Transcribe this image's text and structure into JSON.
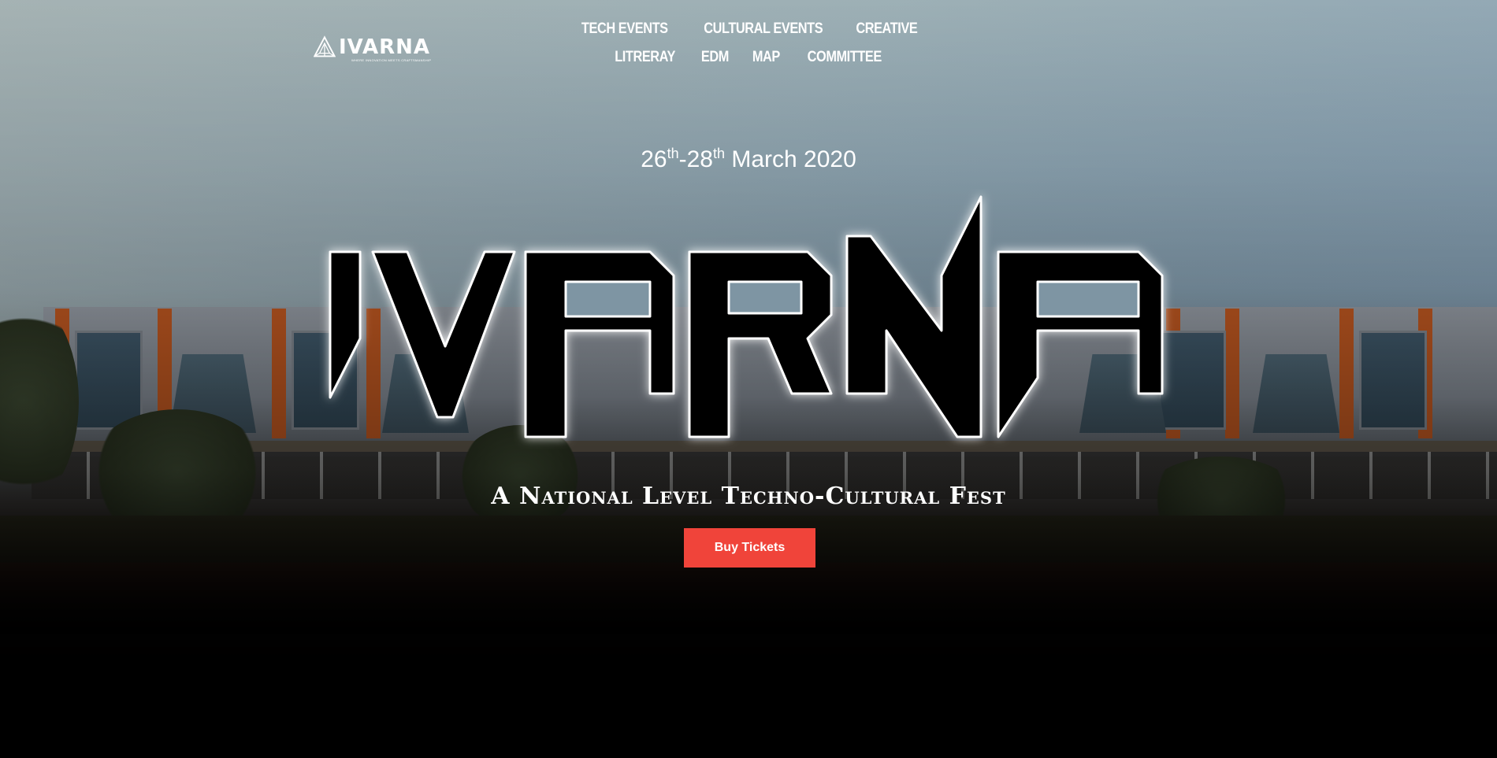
{
  "header": {
    "logo_text": "IVARNA",
    "logo_tagline": "WHERE INNOVATION MEETS CRAFTSMANSHIP",
    "nav": [
      {
        "label": "TECH EVENTS"
      },
      {
        "label": "CULTURAL EVENTS"
      },
      {
        "label": "CREATIVE"
      },
      {
        "label": "LITRERAY"
      },
      {
        "label": "EDM"
      },
      {
        "label": "MAP"
      },
      {
        "label": "COMMITTEE"
      }
    ]
  },
  "hero": {
    "date": {
      "start_day": "26",
      "start_suffix": "th",
      "separator": "-",
      "end_day": "28",
      "end_suffix": "th",
      "rest": " March 2020"
    },
    "title": "IVARNA",
    "tagline": "A National Level Techno-Cultural Fest",
    "cta_label": "Buy Tickets"
  },
  "colors": {
    "cta_background": "#f0443a",
    "title_fill": "#000000",
    "title_stroke": "#ffffff",
    "text": "#ffffff"
  }
}
